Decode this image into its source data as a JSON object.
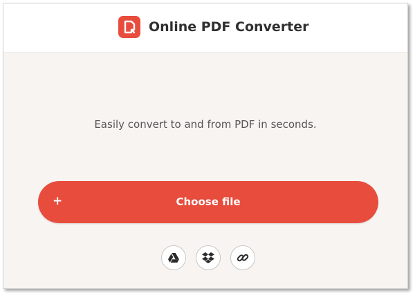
{
  "header": {
    "title": "Online PDF Converter",
    "logo_icon": "pdf-logo-icon"
  },
  "main": {
    "tagline": "Easily convert to and from PDF in seconds.",
    "choose_button": {
      "plus": "+",
      "label": "Choose file"
    },
    "sources": [
      {
        "name": "Google Drive",
        "icon": "google-drive-icon"
      },
      {
        "name": "Dropbox",
        "icon": "dropbox-icon"
      },
      {
        "name": "URL link",
        "icon": "link-icon"
      }
    ]
  },
  "colors": {
    "accent": "#e84c3d",
    "background": "#f7f4f2",
    "header_background": "#ffffff",
    "title_text": "#2f2f2f",
    "body_text": "#555555"
  }
}
